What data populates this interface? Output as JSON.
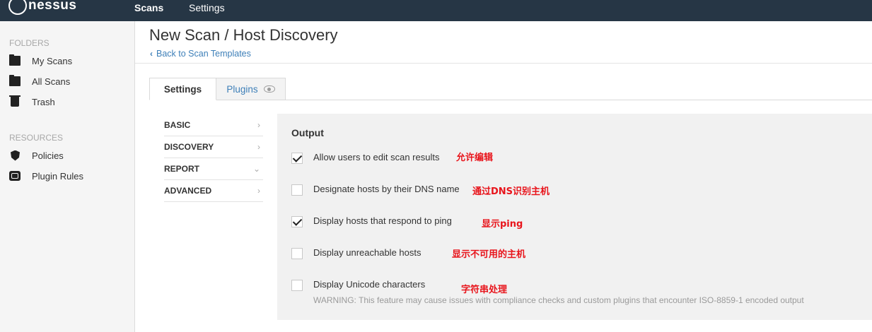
{
  "app": {
    "logo_text": "nessus",
    "nav": {
      "scans": "Scans",
      "settings": "Settings"
    }
  },
  "sidebar": {
    "folders_heading": "FOLDERS",
    "folders": [
      {
        "label": "My Scans",
        "icon": "folder-icon"
      },
      {
        "label": "All Scans",
        "icon": "folder-icon"
      },
      {
        "label": "Trash",
        "icon": "trash-icon"
      }
    ],
    "resources_heading": "RESOURCES",
    "resources": [
      {
        "label": "Policies",
        "icon": "shield-icon"
      },
      {
        "label": "Plugin Rules",
        "icon": "plugin-icon"
      }
    ]
  },
  "main": {
    "title": "New Scan / Host Discovery",
    "back_link": "Back to Scan Templates",
    "tabs": {
      "settings": "Settings",
      "plugins": "Plugins"
    },
    "menu": [
      {
        "label": "BASIC",
        "arrow": "›"
      },
      {
        "label": "DISCOVERY",
        "arrow": "›"
      },
      {
        "label": "REPORT",
        "arrow": "⌄"
      },
      {
        "label": "ADVANCED",
        "arrow": "›"
      }
    ],
    "panel": {
      "title": "Output",
      "options": [
        {
          "label": "Allow users to edit scan results",
          "checked": true,
          "note": "允许编辑"
        },
        {
          "label": "Designate hosts by their DNS name",
          "checked": false,
          "note": "通过DNS识别主机"
        },
        {
          "label": "Display hosts that respond to ping",
          "checked": true,
          "note": "显示ping"
        },
        {
          "label": "Display unreachable hosts",
          "checked": false,
          "note": "显示不可用的主机"
        },
        {
          "label": "Display Unicode characters",
          "checked": false,
          "note": "字符串处理"
        }
      ],
      "warning": "WARNING: This feature may cause issues with compliance checks and custom plugins that encounter ISO-8859-1 encoded output"
    }
  },
  "colors": {
    "topbar": "#263645",
    "link": "#3d7fb8",
    "annotation": "#e8141b",
    "panel_bg": "#f1f1f1"
  }
}
